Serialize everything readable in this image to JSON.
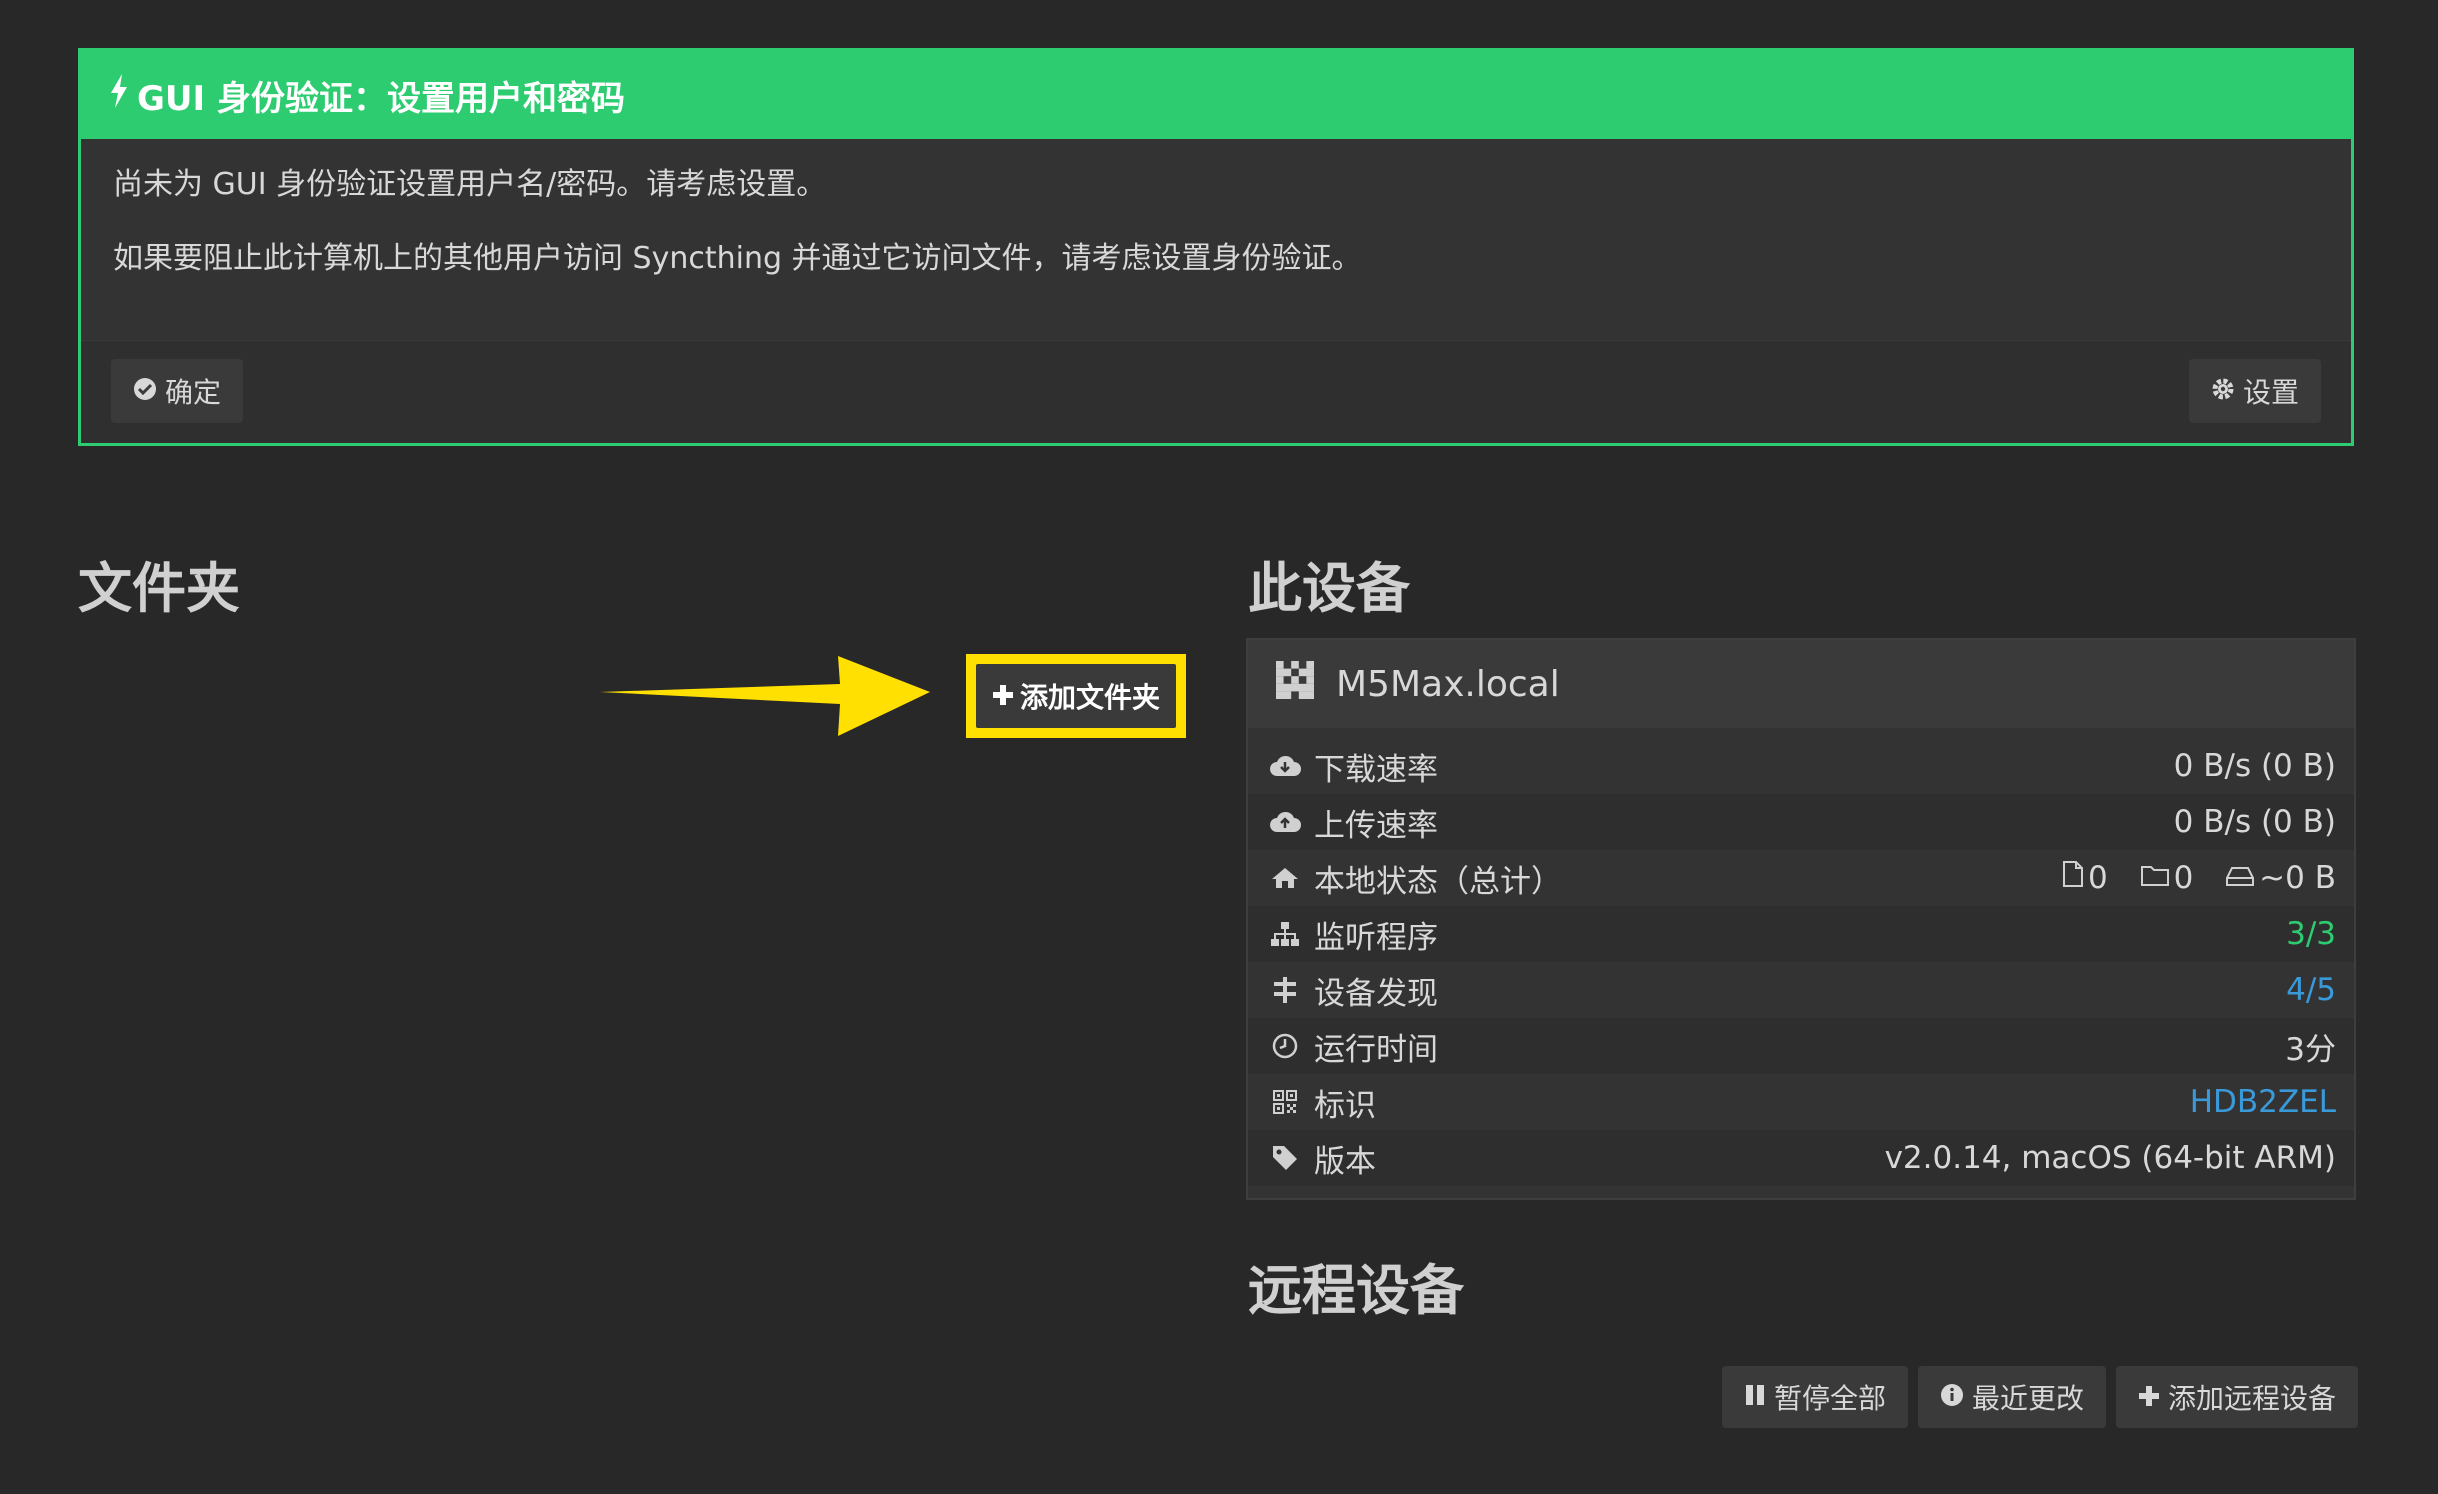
{
  "notice": {
    "title": "GUI 身份验证：设置用户和密码",
    "line1": "尚未为 GUI 身份验证设置用户名/密码。请考虑设置。",
    "line2": "如果要阻止此计算机上的其他用户访问 Syncthing 并通过它访问文件，请考虑设置身份验证。",
    "ok_label": "确定",
    "settings_label": "设置"
  },
  "folders": {
    "title": "文件夹",
    "add_label": "添加文件夹"
  },
  "this_device": {
    "title": "此设备",
    "name": "M5Max.local",
    "rows": [
      {
        "label": "下载速率",
        "value": "0 B/s (0 B)"
      },
      {
        "label": "上传速率",
        "value": "0 B/s (0 B)"
      },
      {
        "label": "本地状态（总计）",
        "files": "0",
        "dirs": "0",
        "size": "~0 B"
      },
      {
        "label": "监听程序",
        "value": "3/3"
      },
      {
        "label": "设备发现",
        "value": "4/5"
      },
      {
        "label": "运行时间",
        "value": "3分"
      },
      {
        "label": "标识",
        "value": "HDB2ZEL"
      },
      {
        "label": "版本",
        "value": "v2.0.14, macOS (64-bit ARM)"
      }
    ]
  },
  "remote_devices": {
    "title": "远程设备",
    "pause_all_label": "暂停全部",
    "recent_changes_label": "最近更改",
    "add_remote_label": "添加远程设备"
  },
  "colors": {
    "accent_green": "#2ecc71",
    "link_blue": "#3a9ad9",
    "highlight_yellow": "#ffe000"
  }
}
